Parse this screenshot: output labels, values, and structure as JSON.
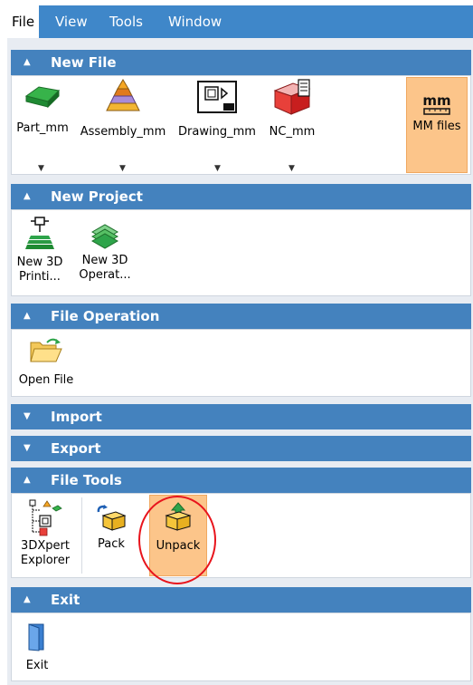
{
  "menu": {
    "items": [
      {
        "label": "File"
      },
      {
        "label": "View"
      },
      {
        "label": "Tools"
      },
      {
        "label": "Window"
      }
    ]
  },
  "sections": {
    "new_file": {
      "title": "New File",
      "tools": [
        {
          "label": "Part_mm"
        },
        {
          "label": "Assembly_mm"
        },
        {
          "label": "Drawing_mm"
        },
        {
          "label": "NC_mm"
        }
      ],
      "mm_files": {
        "icon_text": "mm",
        "label": "MM files"
      }
    },
    "new_project": {
      "title": "New Project",
      "tools": [
        {
          "line1": "New 3D",
          "line2": "Printi..."
        },
        {
          "line1": "New 3D",
          "line2": "Operat..."
        }
      ]
    },
    "file_operation": {
      "title": "File Operation",
      "tools": [
        {
          "label": "Open File"
        }
      ]
    },
    "import": {
      "title": "Import"
    },
    "export": {
      "title": "Export"
    },
    "file_tools": {
      "title": "File Tools",
      "tools": [
        {
          "line1": "3DXpert",
          "line2": "Explorer"
        },
        {
          "label": "Pack"
        },
        {
          "label": "Unpack"
        }
      ]
    },
    "exit": {
      "title": "Exit",
      "tools": [
        {
          "label": "Exit"
        }
      ]
    }
  },
  "arrows": {
    "up": "▲",
    "down": "▼",
    "dropdown": "▼"
  }
}
